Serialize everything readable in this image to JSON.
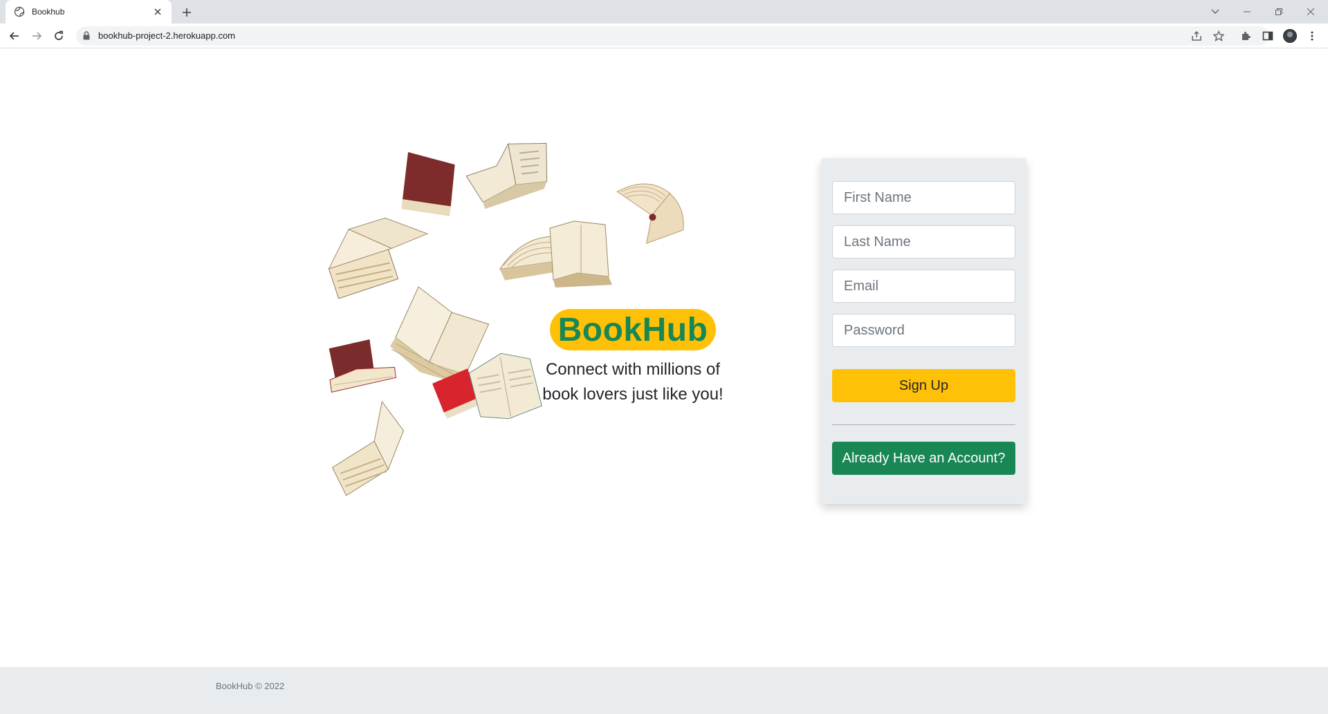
{
  "browser": {
    "tab_title": "Bookhub",
    "url": "bookhub-project-2.herokuapp.com"
  },
  "hero": {
    "brand": "BookHub",
    "tagline": "Connect with millions of book lovers just like you!"
  },
  "signup_form": {
    "first_name": {
      "placeholder": "First Name",
      "value": ""
    },
    "last_name": {
      "placeholder": "Last Name",
      "value": ""
    },
    "email": {
      "placeholder": "Email",
      "value": ""
    },
    "password": {
      "placeholder": "Password",
      "value": ""
    },
    "signup_label": "Sign Up",
    "login_label": "Already Have an Account?"
  },
  "footer": {
    "copyright": "BookHub © 2022"
  },
  "colors": {
    "accent_yellow": "#ffc107",
    "brand_green": "#198754",
    "card_bg": "#e9ecef"
  }
}
